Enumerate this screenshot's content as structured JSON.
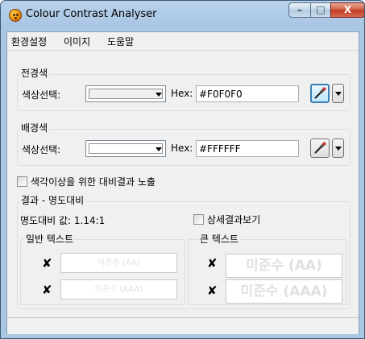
{
  "window": {
    "title": "Colour Contrast Analyser"
  },
  "titlebar_buttons": {
    "minimize": "–",
    "maximize": "□",
    "close": "X"
  },
  "menu": [
    "환경설정",
    "이미지",
    "도움말"
  ],
  "foreground": {
    "group_label": "전경색",
    "picker_label": "색상선택:",
    "swatch_color": "#F0F0F0",
    "hex_label": "Hex:",
    "hex_value": "#F0F0F0"
  },
  "background": {
    "group_label": "배경색",
    "picker_label": "색상선택:",
    "swatch_color": "#FFFFFF",
    "hex_label": "Hex:",
    "hex_value": "#FFFFFF"
  },
  "colorblind_checkbox": {
    "label": "색각이상을 위한 대비결과 노출",
    "checked": false
  },
  "results": {
    "group_label": "결과 - 명도대비",
    "ratio_text": "명도대비 값: 1.14:1",
    "details_checkbox": {
      "label": "상세결과보기",
      "checked": false
    },
    "normal_text": {
      "label": "일반 텍스트",
      "aa": {
        "text": "미준수 (AA)",
        "pass": false
      },
      "aaa": {
        "text": "미준수 (AAA)",
        "pass": false
      }
    },
    "large_text": {
      "label": "큰 텍스트",
      "aa": {
        "text": "미준수 (AA)",
        "pass": false
      },
      "aaa": {
        "text": "미준수 (AAA)",
        "pass": false
      }
    },
    "fail_mark": "✘"
  }
}
